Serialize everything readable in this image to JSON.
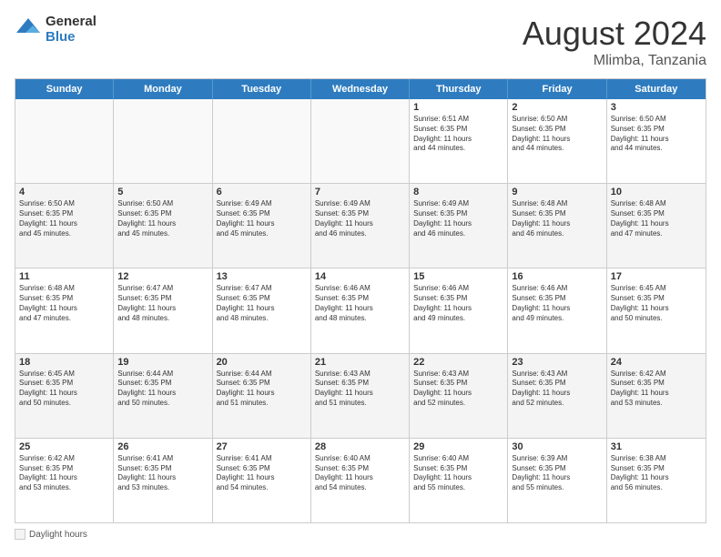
{
  "logo": {
    "general": "General",
    "blue": "Blue"
  },
  "title": "August 2024",
  "location": "Mlimba, Tanzania",
  "days_of_week": [
    "Sunday",
    "Monday",
    "Tuesday",
    "Wednesday",
    "Thursday",
    "Friday",
    "Saturday"
  ],
  "legend_label": "Daylight hours",
  "weeks": [
    [
      {
        "day": "",
        "info": "",
        "empty": true
      },
      {
        "day": "",
        "info": "",
        "empty": true
      },
      {
        "day": "",
        "info": "",
        "empty": true
      },
      {
        "day": "",
        "info": "",
        "empty": true
      },
      {
        "day": "1",
        "info": "Sunrise: 6:51 AM\nSunset: 6:35 PM\nDaylight: 11 hours\nand 44 minutes."
      },
      {
        "day": "2",
        "info": "Sunrise: 6:50 AM\nSunset: 6:35 PM\nDaylight: 11 hours\nand 44 minutes."
      },
      {
        "day": "3",
        "info": "Sunrise: 6:50 AM\nSunset: 6:35 PM\nDaylight: 11 hours\nand 44 minutes."
      }
    ],
    [
      {
        "day": "4",
        "info": "Sunrise: 6:50 AM\nSunset: 6:35 PM\nDaylight: 11 hours\nand 45 minutes."
      },
      {
        "day": "5",
        "info": "Sunrise: 6:50 AM\nSunset: 6:35 PM\nDaylight: 11 hours\nand 45 minutes."
      },
      {
        "day": "6",
        "info": "Sunrise: 6:49 AM\nSunset: 6:35 PM\nDaylight: 11 hours\nand 45 minutes."
      },
      {
        "day": "7",
        "info": "Sunrise: 6:49 AM\nSunset: 6:35 PM\nDaylight: 11 hours\nand 46 minutes."
      },
      {
        "day": "8",
        "info": "Sunrise: 6:49 AM\nSunset: 6:35 PM\nDaylight: 11 hours\nand 46 minutes."
      },
      {
        "day": "9",
        "info": "Sunrise: 6:48 AM\nSunset: 6:35 PM\nDaylight: 11 hours\nand 46 minutes."
      },
      {
        "day": "10",
        "info": "Sunrise: 6:48 AM\nSunset: 6:35 PM\nDaylight: 11 hours\nand 47 minutes."
      }
    ],
    [
      {
        "day": "11",
        "info": "Sunrise: 6:48 AM\nSunset: 6:35 PM\nDaylight: 11 hours\nand 47 minutes."
      },
      {
        "day": "12",
        "info": "Sunrise: 6:47 AM\nSunset: 6:35 PM\nDaylight: 11 hours\nand 48 minutes."
      },
      {
        "day": "13",
        "info": "Sunrise: 6:47 AM\nSunset: 6:35 PM\nDaylight: 11 hours\nand 48 minutes."
      },
      {
        "day": "14",
        "info": "Sunrise: 6:46 AM\nSunset: 6:35 PM\nDaylight: 11 hours\nand 48 minutes."
      },
      {
        "day": "15",
        "info": "Sunrise: 6:46 AM\nSunset: 6:35 PM\nDaylight: 11 hours\nand 49 minutes."
      },
      {
        "day": "16",
        "info": "Sunrise: 6:46 AM\nSunset: 6:35 PM\nDaylight: 11 hours\nand 49 minutes."
      },
      {
        "day": "17",
        "info": "Sunrise: 6:45 AM\nSunset: 6:35 PM\nDaylight: 11 hours\nand 50 minutes."
      }
    ],
    [
      {
        "day": "18",
        "info": "Sunrise: 6:45 AM\nSunset: 6:35 PM\nDaylight: 11 hours\nand 50 minutes."
      },
      {
        "day": "19",
        "info": "Sunrise: 6:44 AM\nSunset: 6:35 PM\nDaylight: 11 hours\nand 50 minutes."
      },
      {
        "day": "20",
        "info": "Sunrise: 6:44 AM\nSunset: 6:35 PM\nDaylight: 11 hours\nand 51 minutes."
      },
      {
        "day": "21",
        "info": "Sunrise: 6:43 AM\nSunset: 6:35 PM\nDaylight: 11 hours\nand 51 minutes."
      },
      {
        "day": "22",
        "info": "Sunrise: 6:43 AM\nSunset: 6:35 PM\nDaylight: 11 hours\nand 52 minutes."
      },
      {
        "day": "23",
        "info": "Sunrise: 6:43 AM\nSunset: 6:35 PM\nDaylight: 11 hours\nand 52 minutes."
      },
      {
        "day": "24",
        "info": "Sunrise: 6:42 AM\nSunset: 6:35 PM\nDaylight: 11 hours\nand 53 minutes."
      }
    ],
    [
      {
        "day": "25",
        "info": "Sunrise: 6:42 AM\nSunset: 6:35 PM\nDaylight: 11 hours\nand 53 minutes."
      },
      {
        "day": "26",
        "info": "Sunrise: 6:41 AM\nSunset: 6:35 PM\nDaylight: 11 hours\nand 53 minutes."
      },
      {
        "day": "27",
        "info": "Sunrise: 6:41 AM\nSunset: 6:35 PM\nDaylight: 11 hours\nand 54 minutes."
      },
      {
        "day": "28",
        "info": "Sunrise: 6:40 AM\nSunset: 6:35 PM\nDaylight: 11 hours\nand 54 minutes."
      },
      {
        "day": "29",
        "info": "Sunrise: 6:40 AM\nSunset: 6:35 PM\nDaylight: 11 hours\nand 55 minutes."
      },
      {
        "day": "30",
        "info": "Sunrise: 6:39 AM\nSunset: 6:35 PM\nDaylight: 11 hours\nand 55 minutes."
      },
      {
        "day": "31",
        "info": "Sunrise: 6:38 AM\nSunset: 6:35 PM\nDaylight: 11 hours\nand 56 minutes."
      }
    ]
  ]
}
